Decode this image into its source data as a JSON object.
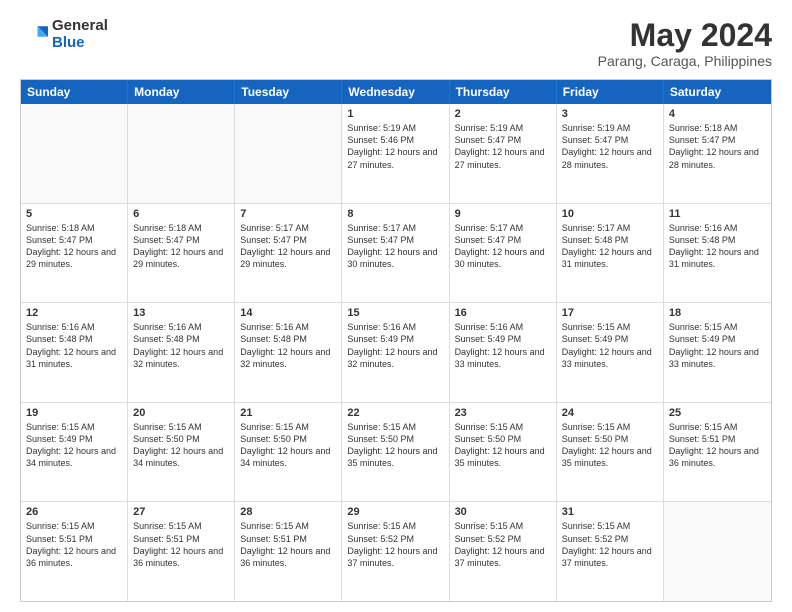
{
  "header": {
    "logo_general": "General",
    "logo_blue": "Blue",
    "month_title": "May 2024",
    "subtitle": "Parang, Caraga, Philippines"
  },
  "calendar": {
    "days_of_week": [
      "Sunday",
      "Monday",
      "Tuesday",
      "Wednesday",
      "Thursday",
      "Friday",
      "Saturday"
    ],
    "weeks": [
      [
        {
          "day": "",
          "empty": true
        },
        {
          "day": "",
          "empty": true
        },
        {
          "day": "",
          "empty": true
        },
        {
          "day": "1",
          "sunrise": "5:19 AM",
          "sunset": "5:46 PM",
          "daylight": "12 hours and 27 minutes."
        },
        {
          "day": "2",
          "sunrise": "5:19 AM",
          "sunset": "5:47 PM",
          "daylight": "12 hours and 27 minutes."
        },
        {
          "day": "3",
          "sunrise": "5:19 AM",
          "sunset": "5:47 PM",
          "daylight": "12 hours and 28 minutes."
        },
        {
          "day": "4",
          "sunrise": "5:18 AM",
          "sunset": "5:47 PM",
          "daylight": "12 hours and 28 minutes."
        }
      ],
      [
        {
          "day": "5",
          "sunrise": "5:18 AM",
          "sunset": "5:47 PM",
          "daylight": "12 hours and 29 minutes."
        },
        {
          "day": "6",
          "sunrise": "5:18 AM",
          "sunset": "5:47 PM",
          "daylight": "12 hours and 29 minutes."
        },
        {
          "day": "7",
          "sunrise": "5:17 AM",
          "sunset": "5:47 PM",
          "daylight": "12 hours and 29 minutes."
        },
        {
          "day": "8",
          "sunrise": "5:17 AM",
          "sunset": "5:47 PM",
          "daylight": "12 hours and 30 minutes."
        },
        {
          "day": "9",
          "sunrise": "5:17 AM",
          "sunset": "5:47 PM",
          "daylight": "12 hours and 30 minutes."
        },
        {
          "day": "10",
          "sunrise": "5:17 AM",
          "sunset": "5:48 PM",
          "daylight": "12 hours and 31 minutes."
        },
        {
          "day": "11",
          "sunrise": "5:16 AM",
          "sunset": "5:48 PM",
          "daylight": "12 hours and 31 minutes."
        }
      ],
      [
        {
          "day": "12",
          "sunrise": "5:16 AM",
          "sunset": "5:48 PM",
          "daylight": "12 hours and 31 minutes."
        },
        {
          "day": "13",
          "sunrise": "5:16 AM",
          "sunset": "5:48 PM",
          "daylight": "12 hours and 32 minutes."
        },
        {
          "day": "14",
          "sunrise": "5:16 AM",
          "sunset": "5:48 PM",
          "daylight": "12 hours and 32 minutes."
        },
        {
          "day": "15",
          "sunrise": "5:16 AM",
          "sunset": "5:49 PM",
          "daylight": "12 hours and 32 minutes."
        },
        {
          "day": "16",
          "sunrise": "5:16 AM",
          "sunset": "5:49 PM",
          "daylight": "12 hours and 33 minutes."
        },
        {
          "day": "17",
          "sunrise": "5:15 AM",
          "sunset": "5:49 PM",
          "daylight": "12 hours and 33 minutes."
        },
        {
          "day": "18",
          "sunrise": "5:15 AM",
          "sunset": "5:49 PM",
          "daylight": "12 hours and 33 minutes."
        }
      ],
      [
        {
          "day": "19",
          "sunrise": "5:15 AM",
          "sunset": "5:49 PM",
          "daylight": "12 hours and 34 minutes."
        },
        {
          "day": "20",
          "sunrise": "5:15 AM",
          "sunset": "5:50 PM",
          "daylight": "12 hours and 34 minutes."
        },
        {
          "day": "21",
          "sunrise": "5:15 AM",
          "sunset": "5:50 PM",
          "daylight": "12 hours and 34 minutes."
        },
        {
          "day": "22",
          "sunrise": "5:15 AM",
          "sunset": "5:50 PM",
          "daylight": "12 hours and 35 minutes."
        },
        {
          "day": "23",
          "sunrise": "5:15 AM",
          "sunset": "5:50 PM",
          "daylight": "12 hours and 35 minutes."
        },
        {
          "day": "24",
          "sunrise": "5:15 AM",
          "sunset": "5:50 PM",
          "daylight": "12 hours and 35 minutes."
        },
        {
          "day": "25",
          "sunrise": "5:15 AM",
          "sunset": "5:51 PM",
          "daylight": "12 hours and 36 minutes."
        }
      ],
      [
        {
          "day": "26",
          "sunrise": "5:15 AM",
          "sunset": "5:51 PM",
          "daylight": "12 hours and 36 minutes."
        },
        {
          "day": "27",
          "sunrise": "5:15 AM",
          "sunset": "5:51 PM",
          "daylight": "12 hours and 36 minutes."
        },
        {
          "day": "28",
          "sunrise": "5:15 AM",
          "sunset": "5:51 PM",
          "daylight": "12 hours and 36 minutes."
        },
        {
          "day": "29",
          "sunrise": "5:15 AM",
          "sunset": "5:52 PM",
          "daylight": "12 hours and 37 minutes."
        },
        {
          "day": "30",
          "sunrise": "5:15 AM",
          "sunset": "5:52 PM",
          "daylight": "12 hours and 37 minutes."
        },
        {
          "day": "31",
          "sunrise": "5:15 AM",
          "sunset": "5:52 PM",
          "daylight": "12 hours and 37 minutes."
        },
        {
          "day": "",
          "empty": true
        }
      ]
    ]
  },
  "labels": {
    "sunrise": "Sunrise:",
    "sunset": "Sunset:",
    "daylight": "Daylight:"
  }
}
